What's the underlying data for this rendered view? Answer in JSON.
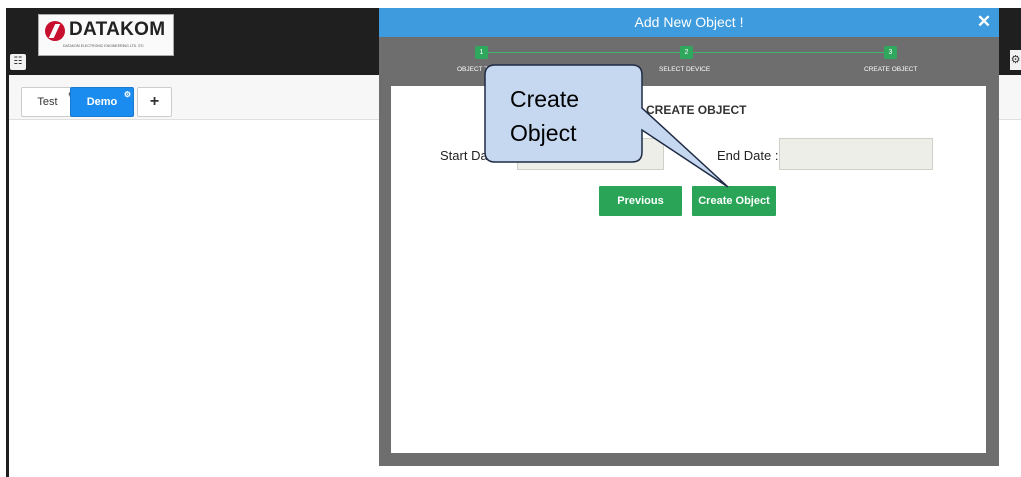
{
  "app": {
    "logo_text": "DATAKOM",
    "logo_subtitle": "DATAKOM ELECTRONIC ENGINEERING LTD. STI.",
    "grid_icon": "grid-icon",
    "right_icon_glyph": "⚙"
  },
  "tabs": [
    {
      "label": "Test",
      "active": false
    },
    {
      "label": "Demo",
      "active": true
    }
  ],
  "tab_add_label": "+",
  "modal": {
    "title": "Add New Object !",
    "close_label": "✕",
    "steps": [
      {
        "number": "1",
        "label": "OBJECT TYPE"
      },
      {
        "number": "2",
        "label": "SELECT DEVICE"
      },
      {
        "number": "3",
        "label": "CREATE OBJECT"
      }
    ],
    "section_title": "CREATE OBJECT",
    "start_date_label": "Start Date :",
    "start_date_value": "",
    "end_date_label": "End Date :",
    "end_date_value": "",
    "previous_label": "Previous",
    "create_label": "Create Object"
  },
  "callout": {
    "text_line1": "Create",
    "text_line2": "Object"
  },
  "colors": {
    "header_blue": "#3d9bde",
    "step_green": "#2fa75c",
    "button_green": "#2aa558",
    "tab_active": "#1a8cf0",
    "callout_fill": "#c5d8f0"
  }
}
